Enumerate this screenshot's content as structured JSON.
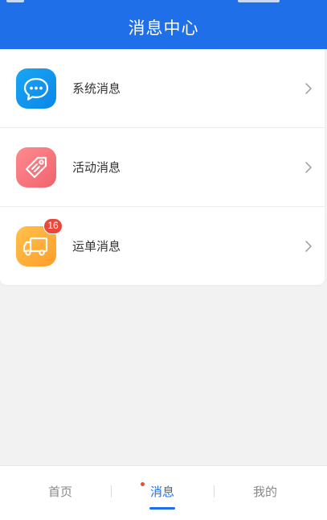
{
  "header": {
    "title": "消息中心"
  },
  "messages": [
    {
      "label": "系统消息",
      "icon": "chat-bubble-icon",
      "color": "#0a86e8",
      "badge": ""
    },
    {
      "label": "活动消息",
      "icon": "tag-icon",
      "color": "#f0636e",
      "badge": ""
    },
    {
      "label": "运单消息",
      "icon": "truck-icon",
      "color": "#ff9d2b",
      "badge": "16"
    }
  ],
  "tabbar": {
    "tabs": [
      {
        "label": "首页",
        "active": false
      },
      {
        "label": "消息",
        "active": true
      },
      {
        "label": "我的",
        "active": false
      }
    ],
    "accent": "#1f6fe8"
  }
}
